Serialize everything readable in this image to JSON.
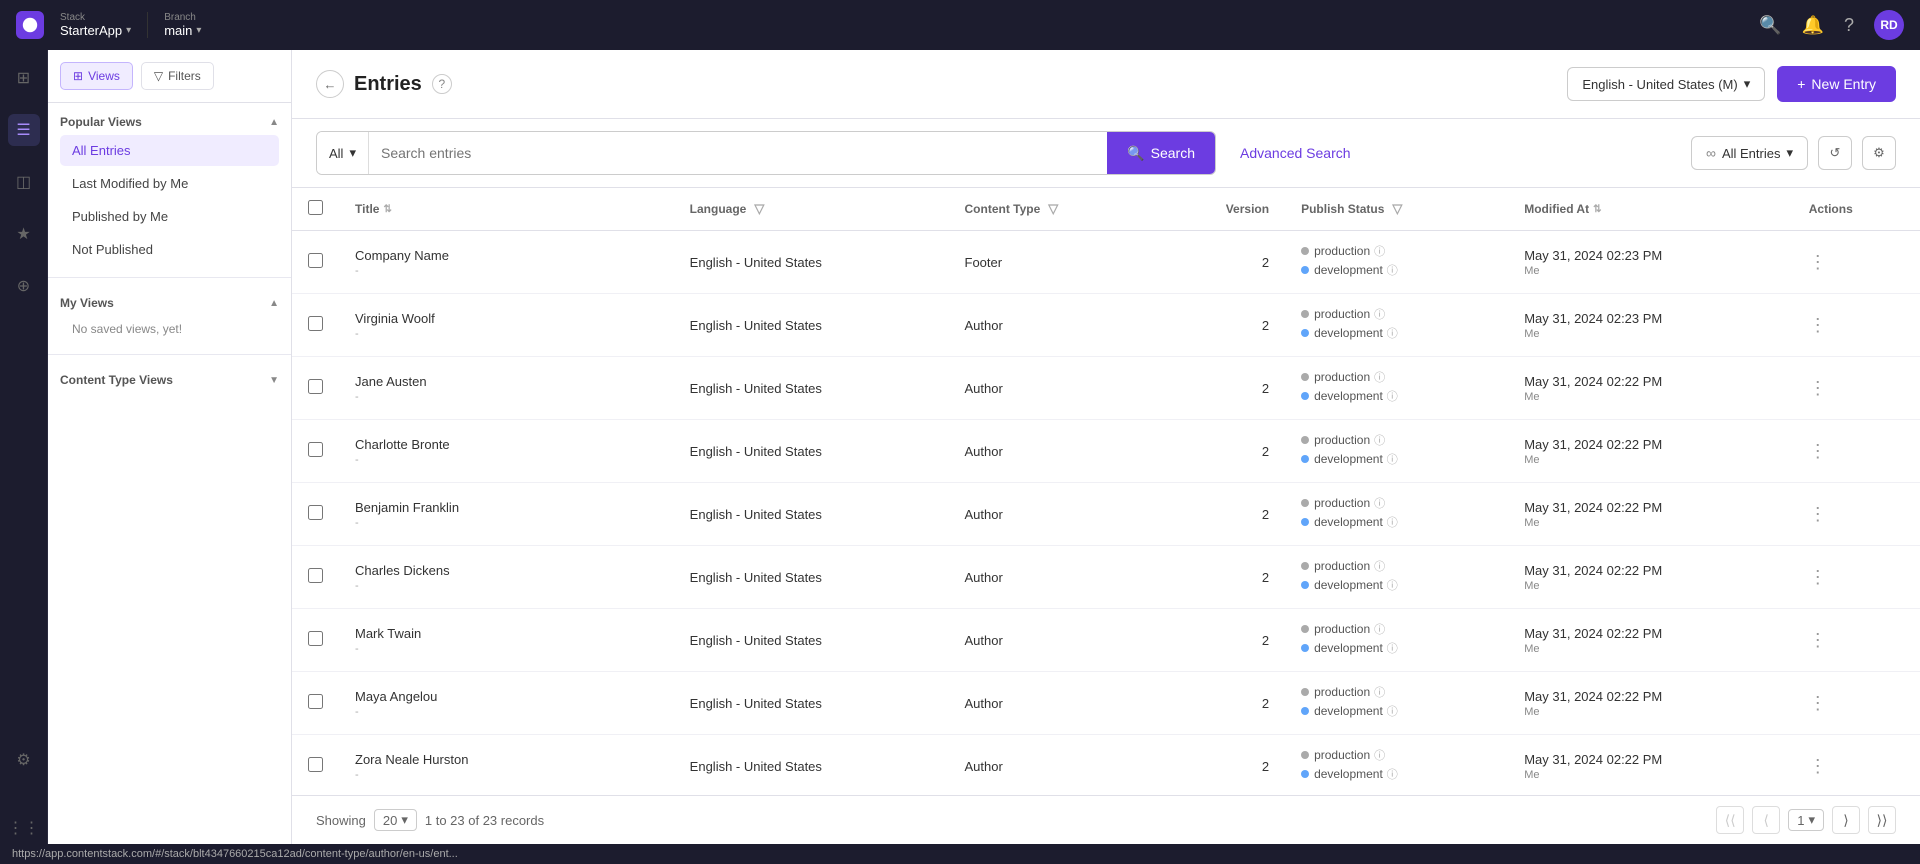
{
  "topbar": {
    "stack_label": "Stack",
    "stack_name": "StarterApp",
    "branch_label": "Branch",
    "branch_name": "main",
    "avatar_initials": "RD"
  },
  "nav": {
    "views_label": "Views",
    "filters_label": "Filters",
    "popular_views_title": "Popular Views",
    "popular_views": [
      {
        "id": "all-entries",
        "label": "All Entries",
        "active": true
      },
      {
        "id": "last-modified",
        "label": "Last Modified by Me",
        "active": false
      },
      {
        "id": "published-by-me",
        "label": "Published by Me",
        "active": false
      },
      {
        "id": "not-published",
        "label": "Not Published",
        "active": false
      }
    ],
    "my_views_title": "My Views",
    "my_views_empty": "No saved views, yet!",
    "content_type_views_title": "Content Type Views"
  },
  "header": {
    "back_icon": "←",
    "title": "Entries",
    "help_icon": "?",
    "language_select": "English - United States (M)",
    "new_entry_label": "New Entry",
    "plus_icon": "+"
  },
  "search": {
    "filter_type": "All",
    "placeholder": "Search entries",
    "search_label": "Search",
    "advanced_search_label": "Advanced Search",
    "all_entries_label": "∞  All Entries",
    "refresh_icon": "↺",
    "settings_icon": "⚙"
  },
  "table": {
    "columns": [
      {
        "id": "title",
        "label": "Title",
        "sortable": true,
        "filterable": false
      },
      {
        "id": "language",
        "label": "Language",
        "sortable": false,
        "filterable": true
      },
      {
        "id": "content_type",
        "label": "Content Type",
        "sortable": false,
        "filterable": true
      },
      {
        "id": "version",
        "label": "Version",
        "sortable": false,
        "filterable": false
      },
      {
        "id": "publish_status",
        "label": "Publish Status",
        "sortable": false,
        "filterable": true
      },
      {
        "id": "modified_at",
        "label": "Modified At",
        "sortable": true,
        "filterable": false
      },
      {
        "id": "actions",
        "label": "Actions",
        "sortable": false,
        "filterable": false
      }
    ],
    "rows": [
      {
        "id": 1,
        "title": "Company Name",
        "sub": "-",
        "language": "English - United States",
        "content_type": "Footer",
        "version": "2",
        "status_prod": "production",
        "status_dev": "development",
        "modified_at": "May 31, 2024 02:23 PM",
        "modified_by": "Me"
      },
      {
        "id": 2,
        "title": "Virginia Woolf",
        "sub": "-",
        "language": "English - United States",
        "content_type": "Author",
        "version": "2",
        "status_prod": "production",
        "status_dev": "development",
        "modified_at": "May 31, 2024 02:23 PM",
        "modified_by": "Me"
      },
      {
        "id": 3,
        "title": "Jane Austen",
        "sub": "-",
        "language": "English - United States",
        "content_type": "Author",
        "version": "2",
        "status_prod": "production",
        "status_dev": "development",
        "modified_at": "May 31, 2024 02:22 PM",
        "modified_by": "Me"
      },
      {
        "id": 4,
        "title": "Charlotte Bronte",
        "sub": "-",
        "language": "English - United States",
        "content_type": "Author",
        "version": "2",
        "status_prod": "production",
        "status_dev": "development",
        "modified_at": "May 31, 2024 02:22 PM",
        "modified_by": "Me"
      },
      {
        "id": 5,
        "title": "Benjamin Franklin",
        "sub": "-",
        "language": "English - United States",
        "content_type": "Author",
        "version": "2",
        "status_prod": "production",
        "status_dev": "development",
        "modified_at": "May 31, 2024 02:22 PM",
        "modified_by": "Me"
      },
      {
        "id": 6,
        "title": "Charles Dickens",
        "sub": "-",
        "language": "English - United States",
        "content_type": "Author",
        "version": "2",
        "status_prod": "production",
        "status_dev": "development",
        "modified_at": "May 31, 2024 02:22 PM",
        "modified_by": "Me"
      },
      {
        "id": 7,
        "title": "Mark Twain",
        "sub": "-",
        "language": "English - United States",
        "content_type": "Author",
        "version": "2",
        "status_prod": "production",
        "status_dev": "development",
        "modified_at": "May 31, 2024 02:22 PM",
        "modified_by": "Me"
      },
      {
        "id": 8,
        "title": "Maya Angelou",
        "sub": "-",
        "language": "English - United States",
        "content_type": "Author",
        "version": "2",
        "status_prod": "production",
        "status_dev": "development",
        "modified_at": "May 31, 2024 02:22 PM",
        "modified_by": "Me"
      },
      {
        "id": 9,
        "title": "Zora Neale Hurston",
        "sub": "-",
        "language": "English - United States",
        "content_type": "Author",
        "version": "2",
        "status_prod": "production",
        "status_dev": "development",
        "modified_at": "May 31, 2024 02:22 PM",
        "modified_by": "Me"
      }
    ]
  },
  "footer": {
    "showing_label": "Showing",
    "page_size": "20",
    "records_info": "1 to 23 of 23 records",
    "current_page": "1"
  },
  "statusbar": {
    "url": "https://app.contentstack.com/#/stack/blt4347660215ca12ad/content-type/author/en-us/ent..."
  },
  "icons": {
    "dashboard": "⊞",
    "list": "☰",
    "layers": "◫",
    "star": "★",
    "map": "⊕",
    "settings": "⚙",
    "grid": "⋮⋮",
    "search": "🔍",
    "bell": "🔔",
    "question": "?",
    "caret_down": "▾"
  }
}
